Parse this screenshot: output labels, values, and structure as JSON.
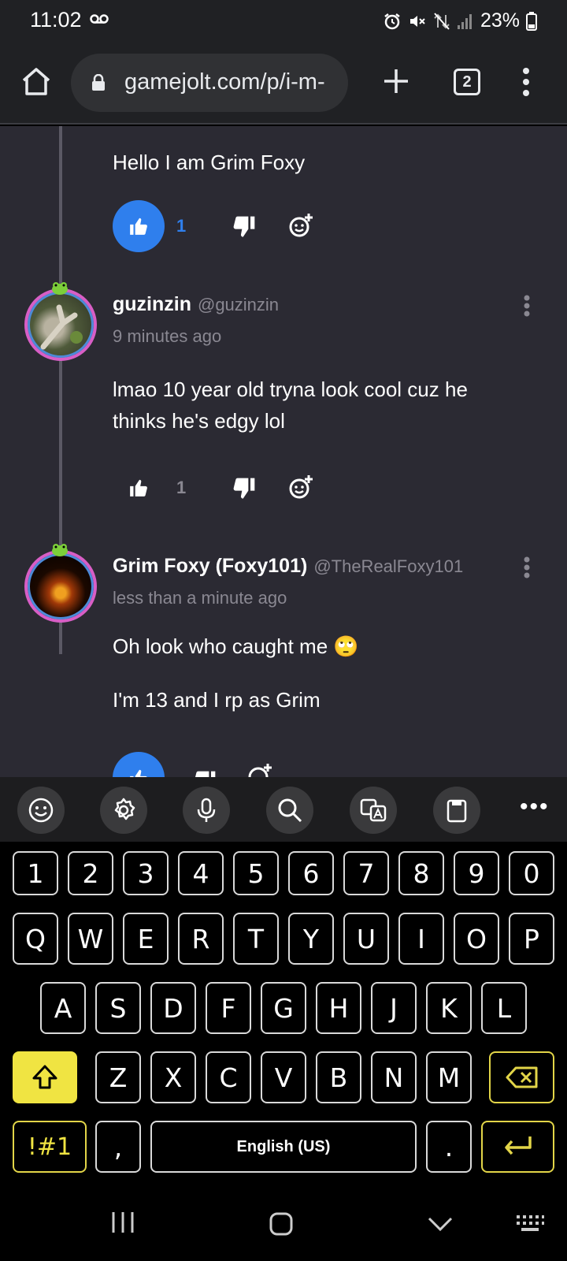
{
  "status_bar": {
    "time": "11:02",
    "battery": "23%"
  },
  "browser": {
    "url": "gamejolt.com/p/i-m-",
    "tab_count": "2"
  },
  "comments": [
    {
      "text": "Hello I am Grim Foxy",
      "like_count": "1",
      "liked": true
    },
    {
      "name": "guzinzin",
      "handle": "@guzinzin",
      "time": "9 minutes ago",
      "text_lines": [
        "lmao 10 year old tryna look cool cuz he",
        "thinks he's edgy lol"
      ],
      "like_count": "1",
      "liked": false
    },
    {
      "name": "Grim Foxy (Foxy101)",
      "handle": "@TheRealFoxy101",
      "time": "less than a minute ago",
      "paragraphs": [
        "Oh look who caught me 🙄",
        "I'm 13 and I rp as Grim"
      ],
      "liked": true
    }
  ],
  "keyboard": {
    "toolbar": [
      "emoji-icon",
      "settings-icon",
      "mic-icon",
      "search-icon",
      "translate-icon",
      "clipboard-icon",
      "more-icon"
    ],
    "row_numbers": [
      "1",
      "2",
      "3",
      "4",
      "5",
      "6",
      "7",
      "8",
      "9",
      "0"
    ],
    "row_top": [
      "Q",
      "W",
      "E",
      "R",
      "T",
      "Y",
      "U",
      "I",
      "O",
      "P"
    ],
    "row_middle": [
      "A",
      "S",
      "D",
      "F",
      "G",
      "H",
      "J",
      "K",
      "L"
    ],
    "row_bottom": [
      "Z",
      "X",
      "C",
      "V",
      "B",
      "N",
      "M"
    ],
    "symbols_label": "!#1",
    "comma": ",",
    "space_label": "English (US)",
    "period": "."
  },
  "colors": {
    "accent_blue": "#2f7fed",
    "content_bg": "#2b2a33",
    "keyboard_yellow": "#f0e442"
  }
}
